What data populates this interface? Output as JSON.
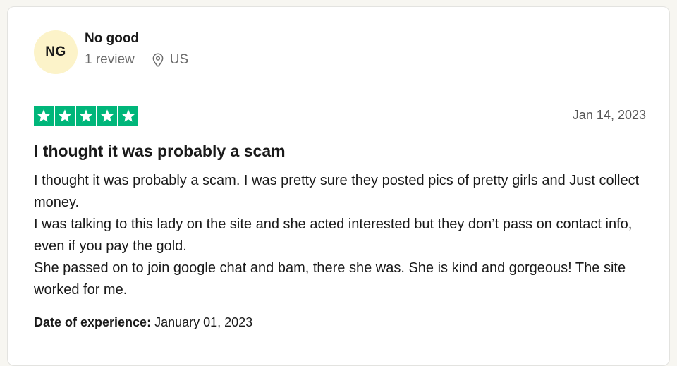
{
  "reviewer": {
    "initials": "NG",
    "name": "No good",
    "review_count": "1 review",
    "country": "US",
    "avatar_color": "#fcf3c9"
  },
  "rating": {
    "stars": 5,
    "max_stars": 5,
    "star_color": "#00b67a"
  },
  "review": {
    "date": "Jan 14, 2023",
    "title": "I thought it was probably a scam",
    "body_lines": [
      "I thought it was probably a scam. I was pretty sure they posted pics of pretty girls and Just collect money.",
      "I was talking to this lady on the site and she acted interested but they don’t pass on contact info, even if you pay the gold.",
      "She passed on to join google chat and bam, there she was. She is kind and gorgeous! The site worked for me."
    ],
    "experience_label": "Date of experience:",
    "experience_date": "January 01, 2023"
  },
  "icons": {
    "location": "map-pin-icon",
    "star": "star-icon"
  }
}
